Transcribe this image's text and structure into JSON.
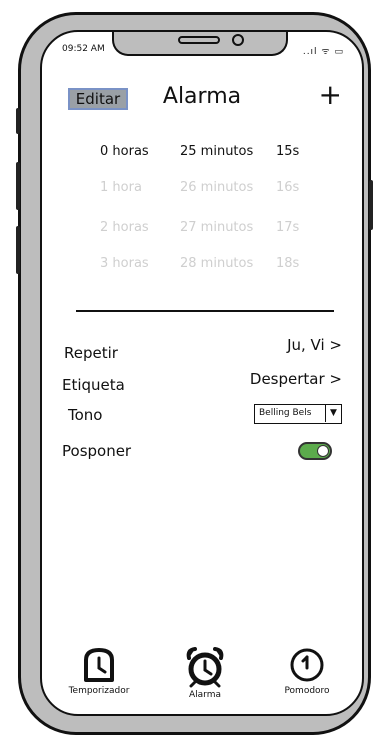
{
  "status_bar": {
    "time": "09:52 AM",
    "icons": "..ıl ᯤ ▭"
  },
  "header": {
    "edit_label": "Editar",
    "title": "Alarma",
    "add_label": "+"
  },
  "picker": {
    "rows": [
      {
        "hours": "0 horas",
        "minutes": "25 minutos",
        "seconds": "15s"
      },
      {
        "hours": "1 hora",
        "minutes": "26 minutos",
        "seconds": "16s"
      },
      {
        "hours": "2 horas",
        "minutes": "27 minutos",
        "seconds": "17s"
      },
      {
        "hours": "3 horas",
        "minutes": "28 minutos",
        "seconds": "18s"
      }
    ]
  },
  "settings": {
    "repeat_label": "Repetir",
    "repeat_value": "Ju, Vi >",
    "label_label": "Etiqueta",
    "label_value": "Despertar >",
    "tone_label": "Tono",
    "tone_value": "Belling Bels",
    "snooze_label": "Posponer",
    "snooze_on": true
  },
  "tabs": [
    {
      "label": "Temporizador",
      "icon": "timer-icon"
    },
    {
      "label": "Alarma",
      "icon": "alarm-clock-icon"
    },
    {
      "label": "Pomodoro",
      "icon": "pomodoro-icon"
    }
  ],
  "colors": {
    "toggle_on": "#5cab4c",
    "edit_bg": "#9aa0a6",
    "edit_border": "#7a92c6",
    "frame": "#bdbdbd"
  }
}
